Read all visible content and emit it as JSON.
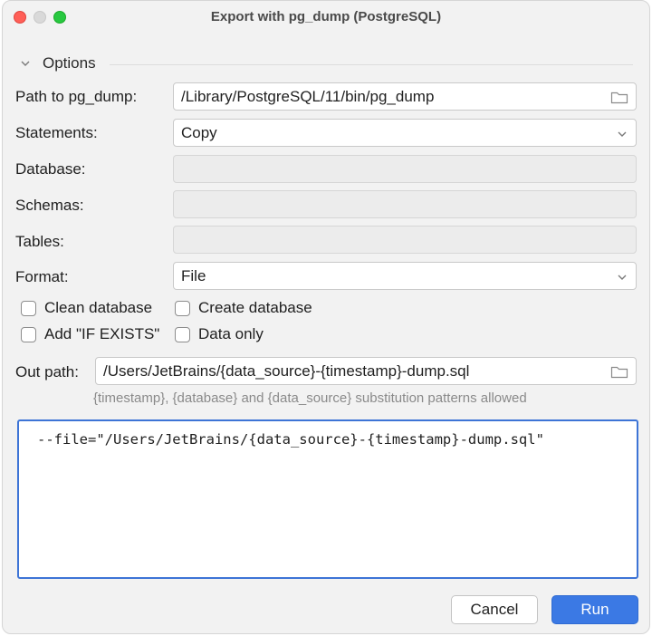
{
  "window": {
    "title": "Export with pg_dump (PostgreSQL)"
  },
  "options": {
    "header": "Options",
    "path_label": "Path to pg_dump:",
    "path_value": "/Library/PostgreSQL/11/bin/pg_dump",
    "statements_label": "Statements:",
    "statements_value": "Copy",
    "database_label": "Database:",
    "database_value": "",
    "schemas_label": "Schemas:",
    "schemas_value": "",
    "tables_label": "Tables:",
    "tables_value": "",
    "format_label": "Format:",
    "format_value": "File",
    "checkboxes": {
      "clean_database": "Clean database",
      "create_database": "Create database",
      "add_if_exists": "Add \"IF EXISTS\"",
      "data_only": "Data only"
    },
    "out_path_label": "Out path:",
    "out_path_value": "/Users/JetBrains/{data_source}-{timestamp}-dump.sql",
    "out_path_hint": "{timestamp}, {database} and {data_source} substitution patterns allowed"
  },
  "command_preview": "--file=\"/Users/JetBrains/{data_source}-{timestamp}-dump.sql\"",
  "buttons": {
    "cancel": "Cancel",
    "run": "Run"
  },
  "icons": {
    "options_toggle": "chevron-down-icon",
    "path_browse": "folder-icon",
    "statements_dropdown": "chevron-down-icon",
    "format_dropdown": "chevron-down-icon",
    "out_path_browse": "folder-icon"
  },
  "colors": {
    "primary": "#3b79e4",
    "focus_border": "#3d74d6",
    "close": "#ff5f57",
    "maximize": "#28c840"
  }
}
